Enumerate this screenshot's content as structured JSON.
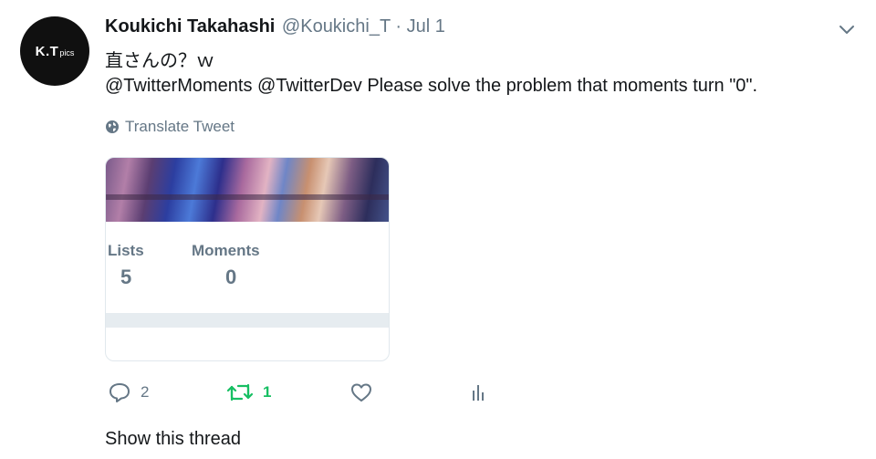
{
  "author": {
    "avatar_text": "K.T",
    "avatar_subtext": "pics",
    "name": "Koukichi Takahashi",
    "handle": "@Koukichi_T",
    "separator": "·",
    "time": "Jul 1"
  },
  "tweet": {
    "line1": "直さんの？ｗ",
    "mention1": "@TwitterMoments",
    "mention2": "@TwitterDev",
    "text": "Please solve the problem that moments turn \"0\"."
  },
  "translate_label": "Translate Tweet",
  "card": {
    "lists_label": "Lists",
    "lists_value": "5",
    "moments_label": "Moments",
    "moments_value": "0"
  },
  "actions": {
    "reply_count": "2",
    "retweet_count": "1"
  },
  "show_thread_label": "Show this thread",
  "colors": {
    "text": "#14171a",
    "secondary": "#657786",
    "retweet_green": "#17bf63",
    "border": "#e1e8ed"
  },
  "icons": [
    "chevron-down-icon",
    "globe-icon",
    "reply-icon",
    "retweet-icon",
    "heart-icon",
    "analytics-icon"
  ]
}
